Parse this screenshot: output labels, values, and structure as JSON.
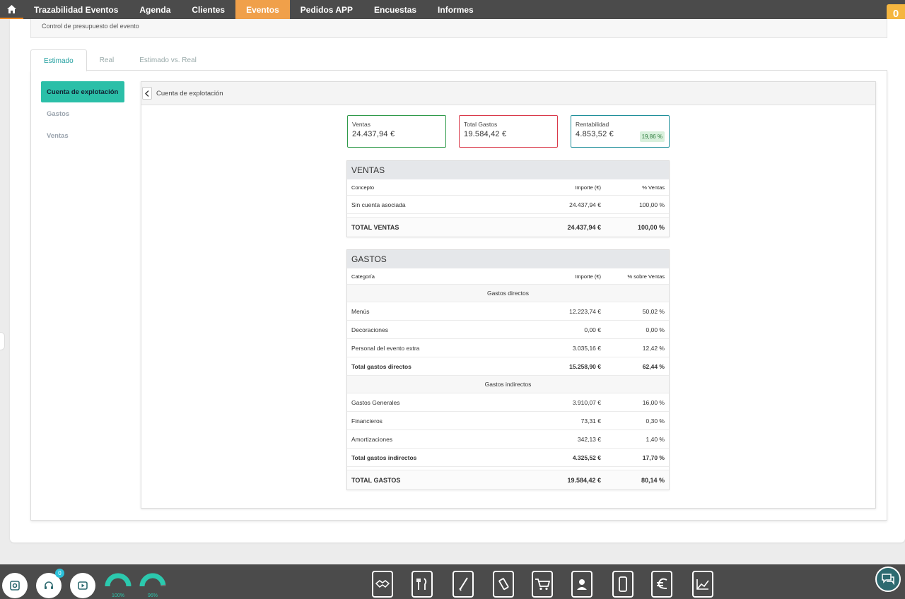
{
  "nav": {
    "items": [
      "Trazabilidad Eventos",
      "Agenda",
      "Clientes",
      "Eventos",
      "Pedidos APP",
      "Encuestas",
      "Informes"
    ],
    "active_index": 3,
    "badge": "0"
  },
  "breadcrumb": "Control de presupuesto del evento",
  "tabs": [
    "Estimado",
    "Real",
    "Estimado vs. Real"
  ],
  "sidemenu": [
    "Cuenta de explotación",
    "Gastos",
    "Ventas"
  ],
  "panel_title": "Cuenta de explotación",
  "kpis": {
    "ventas": {
      "label": "Ventas",
      "value": "24.437,94 €"
    },
    "gastos": {
      "label": "Total Gastos",
      "value": "19.584,42 €"
    },
    "rentabilidad": {
      "label": "Rentabilidad",
      "value": "4.853,52 €",
      "badge": "19,86 %"
    }
  },
  "ventas_table": {
    "title": "VENTAS",
    "headers": [
      "Concepto",
      "Importe (€)",
      "% Ventas"
    ],
    "rows": [
      [
        "Sin cuenta asociada",
        "24.437,94 €",
        "100,00 %"
      ]
    ],
    "total": [
      "TOTAL VENTAS",
      "24.437,94 €",
      "100,00 %"
    ]
  },
  "gastos_table": {
    "title": "GASTOS",
    "headers": [
      "Categoría",
      "Importe (€)",
      "% sobre Ventas"
    ],
    "group_directos": "Gastos directos",
    "directos": [
      [
        "Menús",
        "12.223,74 €",
        "50,02 %"
      ],
      [
        "Decoraciones",
        "0,00 €",
        "0,00 %"
      ],
      [
        "Personal del evento extra",
        "3.035,16 €",
        "12,42 %"
      ]
    ],
    "subtotal_directos": [
      "Total gastos directos",
      "15.258,90 €",
      "62,44 %"
    ],
    "group_indirectos": "Gastos indirectos",
    "indirectos": [
      [
        "Gastos Generales",
        "3.910,07 €",
        "16,00 %"
      ],
      [
        "Financieros",
        "73,31 €",
        "0,30 %"
      ],
      [
        "Amortizaciones",
        "342,13 €",
        "1,40 %"
      ]
    ],
    "subtotal_indirectos": [
      "Total gastos indirectos",
      "4.325,52 €",
      "17,70 %"
    ],
    "total": [
      "TOTAL GASTOS",
      "19.584,42 €",
      "80,14 %"
    ]
  },
  "bottom": {
    "notif_count": "0",
    "gauge1": "100%",
    "gauge2": "96%",
    "gauge1_level": 1.0,
    "gauge2_level": 0.96,
    "apps": [
      "handshake-icon",
      "menu-icon",
      "whisk-icon",
      "drink-icon",
      "cart-icon",
      "contacts-icon",
      "phone-icon",
      "euro-icon",
      "chart-icon"
    ]
  },
  "colors": {
    "accent": "#2bbfa8",
    "nav_active": "#f0a04a",
    "ventas_border": "#2f9a4a",
    "gastos_border": "#d9394a",
    "rentabilidad_border": "#1f8f9a"
  }
}
